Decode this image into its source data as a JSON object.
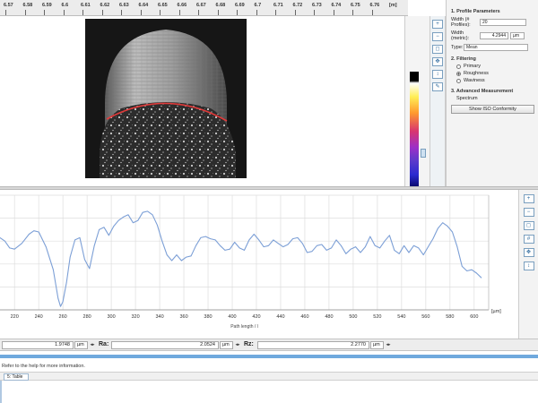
{
  "ruler": {
    "ticks": [
      "6.57",
      "6.58",
      "6.59",
      "6.6",
      "6.61",
      "6.62",
      "6.63",
      "6.64",
      "6.65",
      "6.66",
      "6.67",
      "6.68",
      "6.69",
      "6.7",
      "6.71",
      "6.72",
      "6.73",
      "6.74",
      "6.75",
      "6.76"
    ],
    "unit": "[m]"
  },
  "panel": {
    "section1": "1. Profile Parameters",
    "width_profiles_label": "Width (# Profiles):",
    "width_profiles_value": "20",
    "width_metric_label": "Width (metric):",
    "width_metric_value": "4.2944",
    "width_metric_unit": "µm",
    "type_label": "Type:",
    "type_value": "Mean",
    "section2": "2. Filtering",
    "filter_options": [
      "Primary",
      "Roughness",
      "Waviness"
    ],
    "filter_selected": "Roughness",
    "section3": "3. Advanced Measurement",
    "spectrum_label": "Spectrum",
    "iso_button": "Show ISO Conformity"
  },
  "icons": {
    "image_tools": [
      "zoom-in-icon",
      "zoom-out-icon",
      "zoom-fit-icon",
      "pan-icon",
      "marker-icon",
      "pen-icon"
    ],
    "graph_tools": [
      "zoom-in-icon",
      "zoom-out-icon",
      "zoom-fit-icon",
      "grid-icon",
      "pan-icon",
      "marker-icon"
    ]
  },
  "chart_data": {
    "type": "line",
    "title": "",
    "xlabel": "Path length / l",
    "xunit": "[µm]",
    "xlim": [
      208,
      612
    ],
    "ylim": [
      0,
      10
    ],
    "xticks": [
      220,
      240,
      260,
      280,
      300,
      320,
      340,
      360,
      380,
      400,
      420,
      440,
      460,
      480,
      500,
      520,
      540,
      560,
      580,
      600
    ],
    "grid": true,
    "series": [
      {
        "color": "#7c9fd6",
        "x": [
          208,
          212,
          216,
          220,
          226,
          232,
          236,
          240,
          246,
          252,
          256,
          258,
          260,
          263,
          266,
          270,
          274,
          278,
          282,
          286,
          290,
          294,
          298,
          302,
          306,
          310,
          314,
          318,
          322,
          326,
          330,
          334,
          338,
          342,
          346,
          350,
          354,
          358,
          362,
          366,
          370,
          374,
          378,
          382,
          386,
          390,
          394,
          398,
          402,
          406,
          410,
          414,
          418,
          422,
          426,
          430,
          434,
          438,
          442,
          446,
          450,
          454,
          458,
          462,
          466,
          470,
          474,
          478,
          482,
          486,
          490,
          494,
          498,
          502,
          506,
          510,
          514,
          518,
          522,
          526,
          530,
          534,
          538,
          542,
          546,
          550,
          554,
          558,
          562,
          566,
          570,
          574,
          578,
          582,
          586,
          590,
          594,
          598,
          602,
          606
        ],
        "y": [
          6.3,
          6.0,
          5.4,
          5.3,
          5.8,
          6.6,
          6.9,
          6.8,
          5.5,
          3.5,
          1.0,
          0.3,
          0.7,
          2.4,
          4.6,
          6.1,
          6.3,
          4.4,
          3.6,
          5.6,
          7.0,
          7.2,
          6.5,
          7.3,
          7.8,
          8.1,
          8.3,
          7.6,
          7.8,
          8.5,
          8.6,
          8.3,
          7.4,
          6.0,
          4.8,
          4.3,
          4.8,
          4.3,
          4.6,
          4.7,
          5.6,
          6.3,
          6.4,
          6.2,
          6.1,
          5.6,
          5.2,
          5.3,
          5.9,
          5.4,
          5.2,
          6.1,
          6.6,
          6.1,
          5.5,
          5.6,
          6.1,
          5.8,
          5.5,
          5.7,
          6.2,
          6.3,
          5.8,
          5.0,
          5.1,
          5.6,
          5.7,
          5.2,
          5.4,
          6.1,
          5.6,
          4.9,
          5.3,
          5.5,
          5.0,
          5.5,
          6.4,
          5.6,
          5.4,
          6.0,
          6.5,
          5.2,
          4.9,
          5.6,
          5.0,
          5.6,
          5.4,
          4.8,
          5.5,
          6.2,
          7.1,
          7.6,
          7.3,
          6.8,
          5.5,
          3.8,
          3.4,
          3.5,
          3.2,
          2.8
        ]
      }
    ]
  },
  "values": [
    {
      "value": "1.9748",
      "unit": "µm",
      "label": ""
    },
    {
      "value": "2.0524",
      "unit": "µm",
      "label": "Ra:"
    },
    {
      "value": "2.2770",
      "unit": "µm",
      "label": "Rz:"
    }
  ],
  "status": "Refer to the help for more information.",
  "tab": "5: Table"
}
